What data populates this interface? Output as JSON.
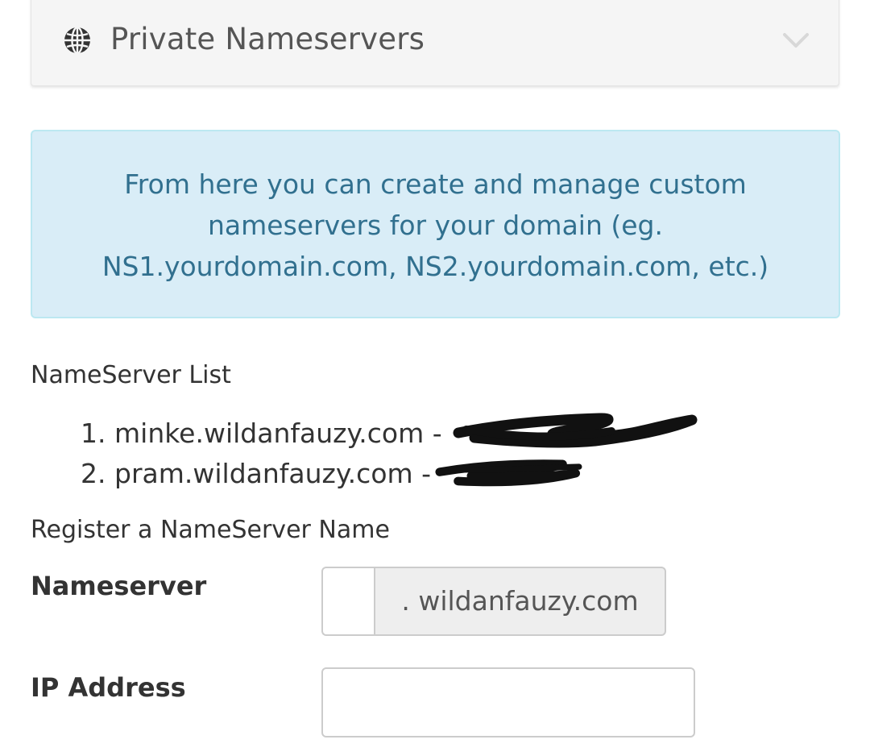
{
  "panel": {
    "title": "Private Nameservers",
    "icon": "globe-icon",
    "toggle_icon": "chevron-down-icon"
  },
  "info": {
    "lines": [
      "From here you can create and manage custom",
      "nameservers for your domain (eg.",
      "NS1.yourdomain.com, NS2.yourdomain.com, etc.)"
    ]
  },
  "nameserver_list": {
    "heading": "NameServer List",
    "items": [
      {
        "index": "1.",
        "host": "minke.wildanfauzy.com",
        "separator": "-",
        "ip_redacted": true
      },
      {
        "index": "2.",
        "host": "pram.wildanfauzy.com",
        "separator": "-",
        "ip_redacted": true
      }
    ]
  },
  "register": {
    "heading": "Register a NameServer Name",
    "nameserver_label": "Nameserver",
    "nameserver_value": "",
    "domain_suffix": ". wildanfauzy.com",
    "ip_label": "IP Address",
    "ip_value": ""
  },
  "colors": {
    "info_text": "#31708f",
    "info_bg": "#d9edf7",
    "info_border": "#bce8f1",
    "panel_bg": "#f5f5f5",
    "addon_bg": "#eeeeee",
    "redaction": "#111111"
  }
}
